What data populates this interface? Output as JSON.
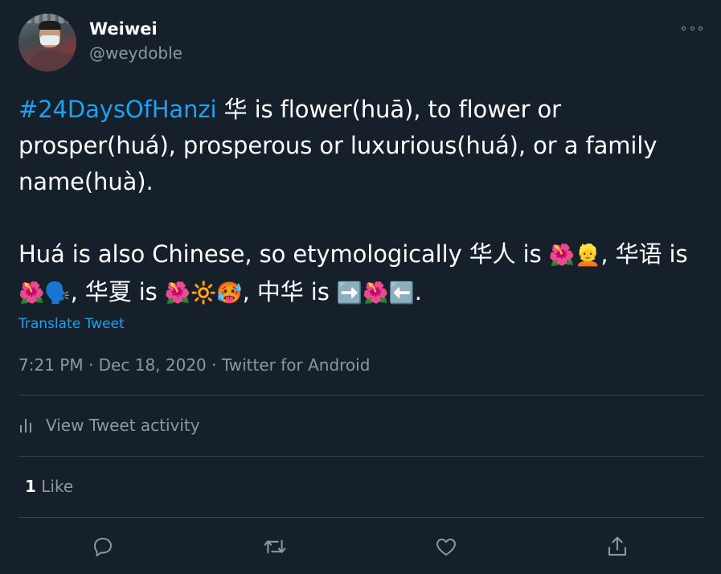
{
  "author": {
    "display_name": "Weiwei",
    "handle": "@weydoble"
  },
  "tweet": {
    "hashtag": "#24DaysOfHanzi",
    "line1_rest": " 华 is flower(huā), to flower or prosper(huá), prosperous or luxurious(huá), or a family name(huà).",
    "p2_a": "Huá is also Chinese, so etymologically 华人 is ",
    "p2_b": ", 华语 is ",
    "p2_c": ", 华夏 is ",
    "p2_d": ", 中华 is ",
    "p2_end": ".",
    "emoji": {
      "hibiscus": "🌺",
      "person": "👱",
      "speaking_head": "🗣️",
      "sun": "🔆",
      "hot_face": "🥵",
      "arrow_right": "➡️",
      "arrow_left": "⬅️"
    }
  },
  "translate_label": "Translate Tweet",
  "meta": "7:21 PM · Dec 18, 2020 · Twitter for Android",
  "activity_label": "View Tweet activity",
  "likes": {
    "count": "1",
    "label": "Like"
  },
  "colors": {
    "background": "#15202b",
    "accent": "#1da1f2",
    "muted": "#8899a6",
    "divider": "#38444d"
  },
  "icons": [
    "more-icon",
    "analytics-icon",
    "reply-icon",
    "retweet-icon",
    "like-icon",
    "share-icon"
  ]
}
